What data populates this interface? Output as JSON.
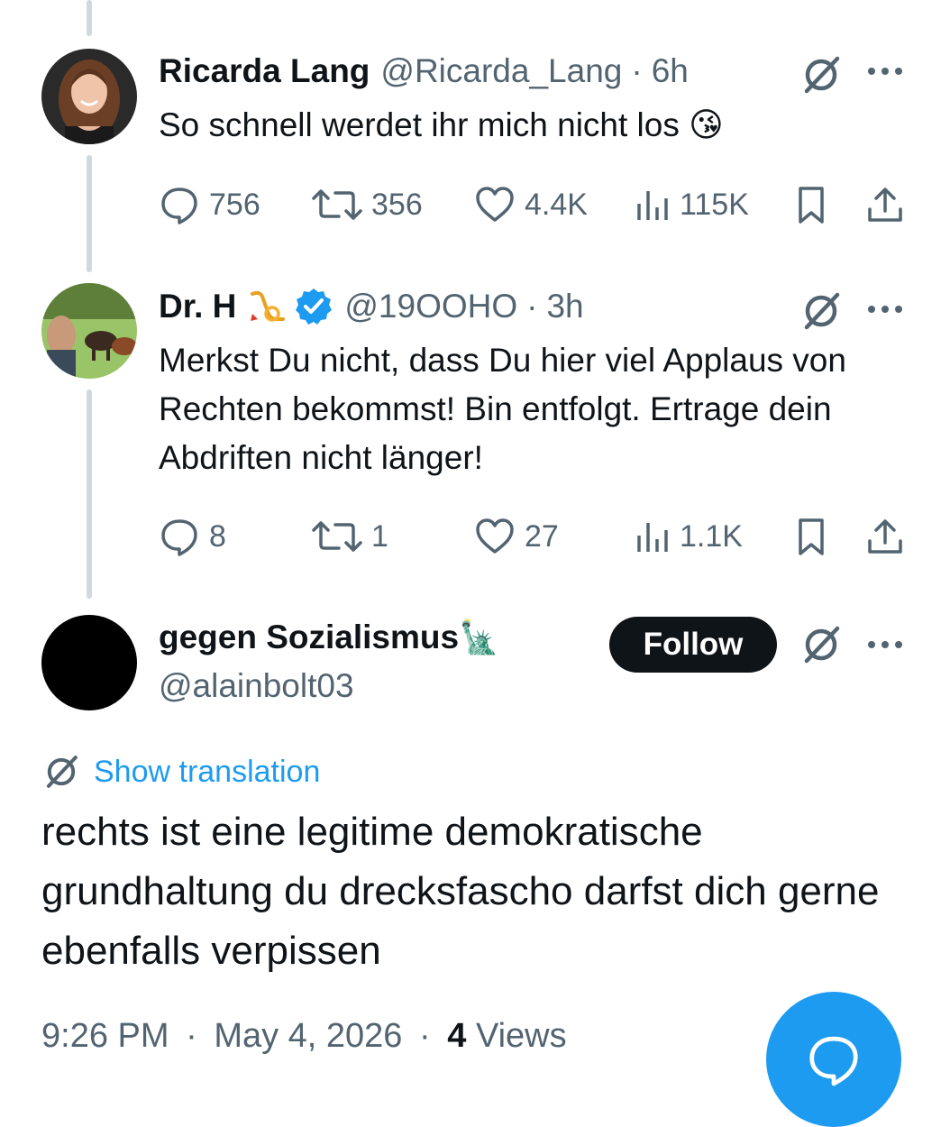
{
  "thread": [
    {
      "name": "Ricarda Lang",
      "handle": "@Ricarda_Lang",
      "separator": "·",
      "time": "6h",
      "text": "So schnell werdet ihr mich nicht los 😘",
      "stats": {
        "replies": "756",
        "reposts": "356",
        "likes": "4.4K",
        "views": "115K"
      }
    },
    {
      "name": "Dr. H",
      "handle": "@19OOHO",
      "separator": "·",
      "time": "3h",
      "text": "Merkst Du nicht, dass Du hier viel Applaus von Rechten bekommst! Bin entfolgt. Ertrage dein Abdriften nicht länger!",
      "stats": {
        "replies": "8",
        "reposts": "1",
        "likes": "27",
        "views": "1.1K"
      }
    }
  ],
  "focus": {
    "name": "gegen Sozialismus",
    "name_emoji": "🗽",
    "handle": "@alainbolt03",
    "follow_label": "Follow",
    "show_translation": "Show translation",
    "text": "rechts ist eine legitime demokratische grundhaltung du drecksfascho darfst dich gerne ebenfalls verpissen",
    "time": "9:26 PM",
    "separator": "·",
    "date": "May 4, 2026",
    "views_count": "4",
    "views_label": "Views"
  },
  "colors": {
    "accent": "#1d9bf0",
    "text_primary": "#0f1419",
    "text_secondary": "#536471",
    "thread_line": "#cfd9de",
    "verified": "#1d9bf0"
  },
  "icons": {
    "grok": "grok-icon",
    "more": "more-icon",
    "reply": "reply-icon",
    "repost": "repost-icon",
    "like": "like-icon",
    "views": "views-icon",
    "bookmark": "bookmark-icon",
    "share": "share-icon",
    "verified": "verified-badge-icon",
    "compose_reply": "reply-fab-icon"
  }
}
